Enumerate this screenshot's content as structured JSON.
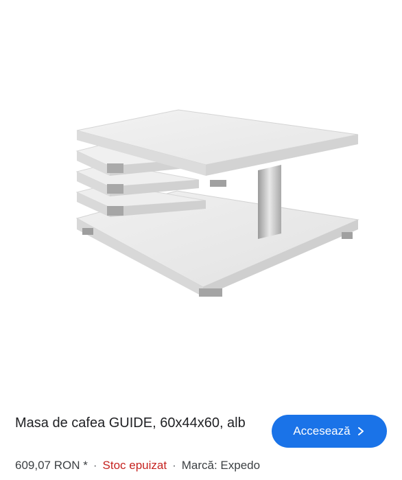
{
  "product": {
    "title": "Masa de cafea GUIDE, 60x44x60, alb",
    "price": "609,07 RON *",
    "stock_status": "Stoc epuizat",
    "brand": "Marcă: Expedo",
    "separator": "·",
    "image_icon": "coffee-table-product-photo"
  },
  "cta": {
    "label": "Accesează",
    "icon": "chevron-right-icon"
  },
  "colors": {
    "accent": "#1a73e8",
    "stock_out": "#c5221f",
    "text": "#202124"
  }
}
